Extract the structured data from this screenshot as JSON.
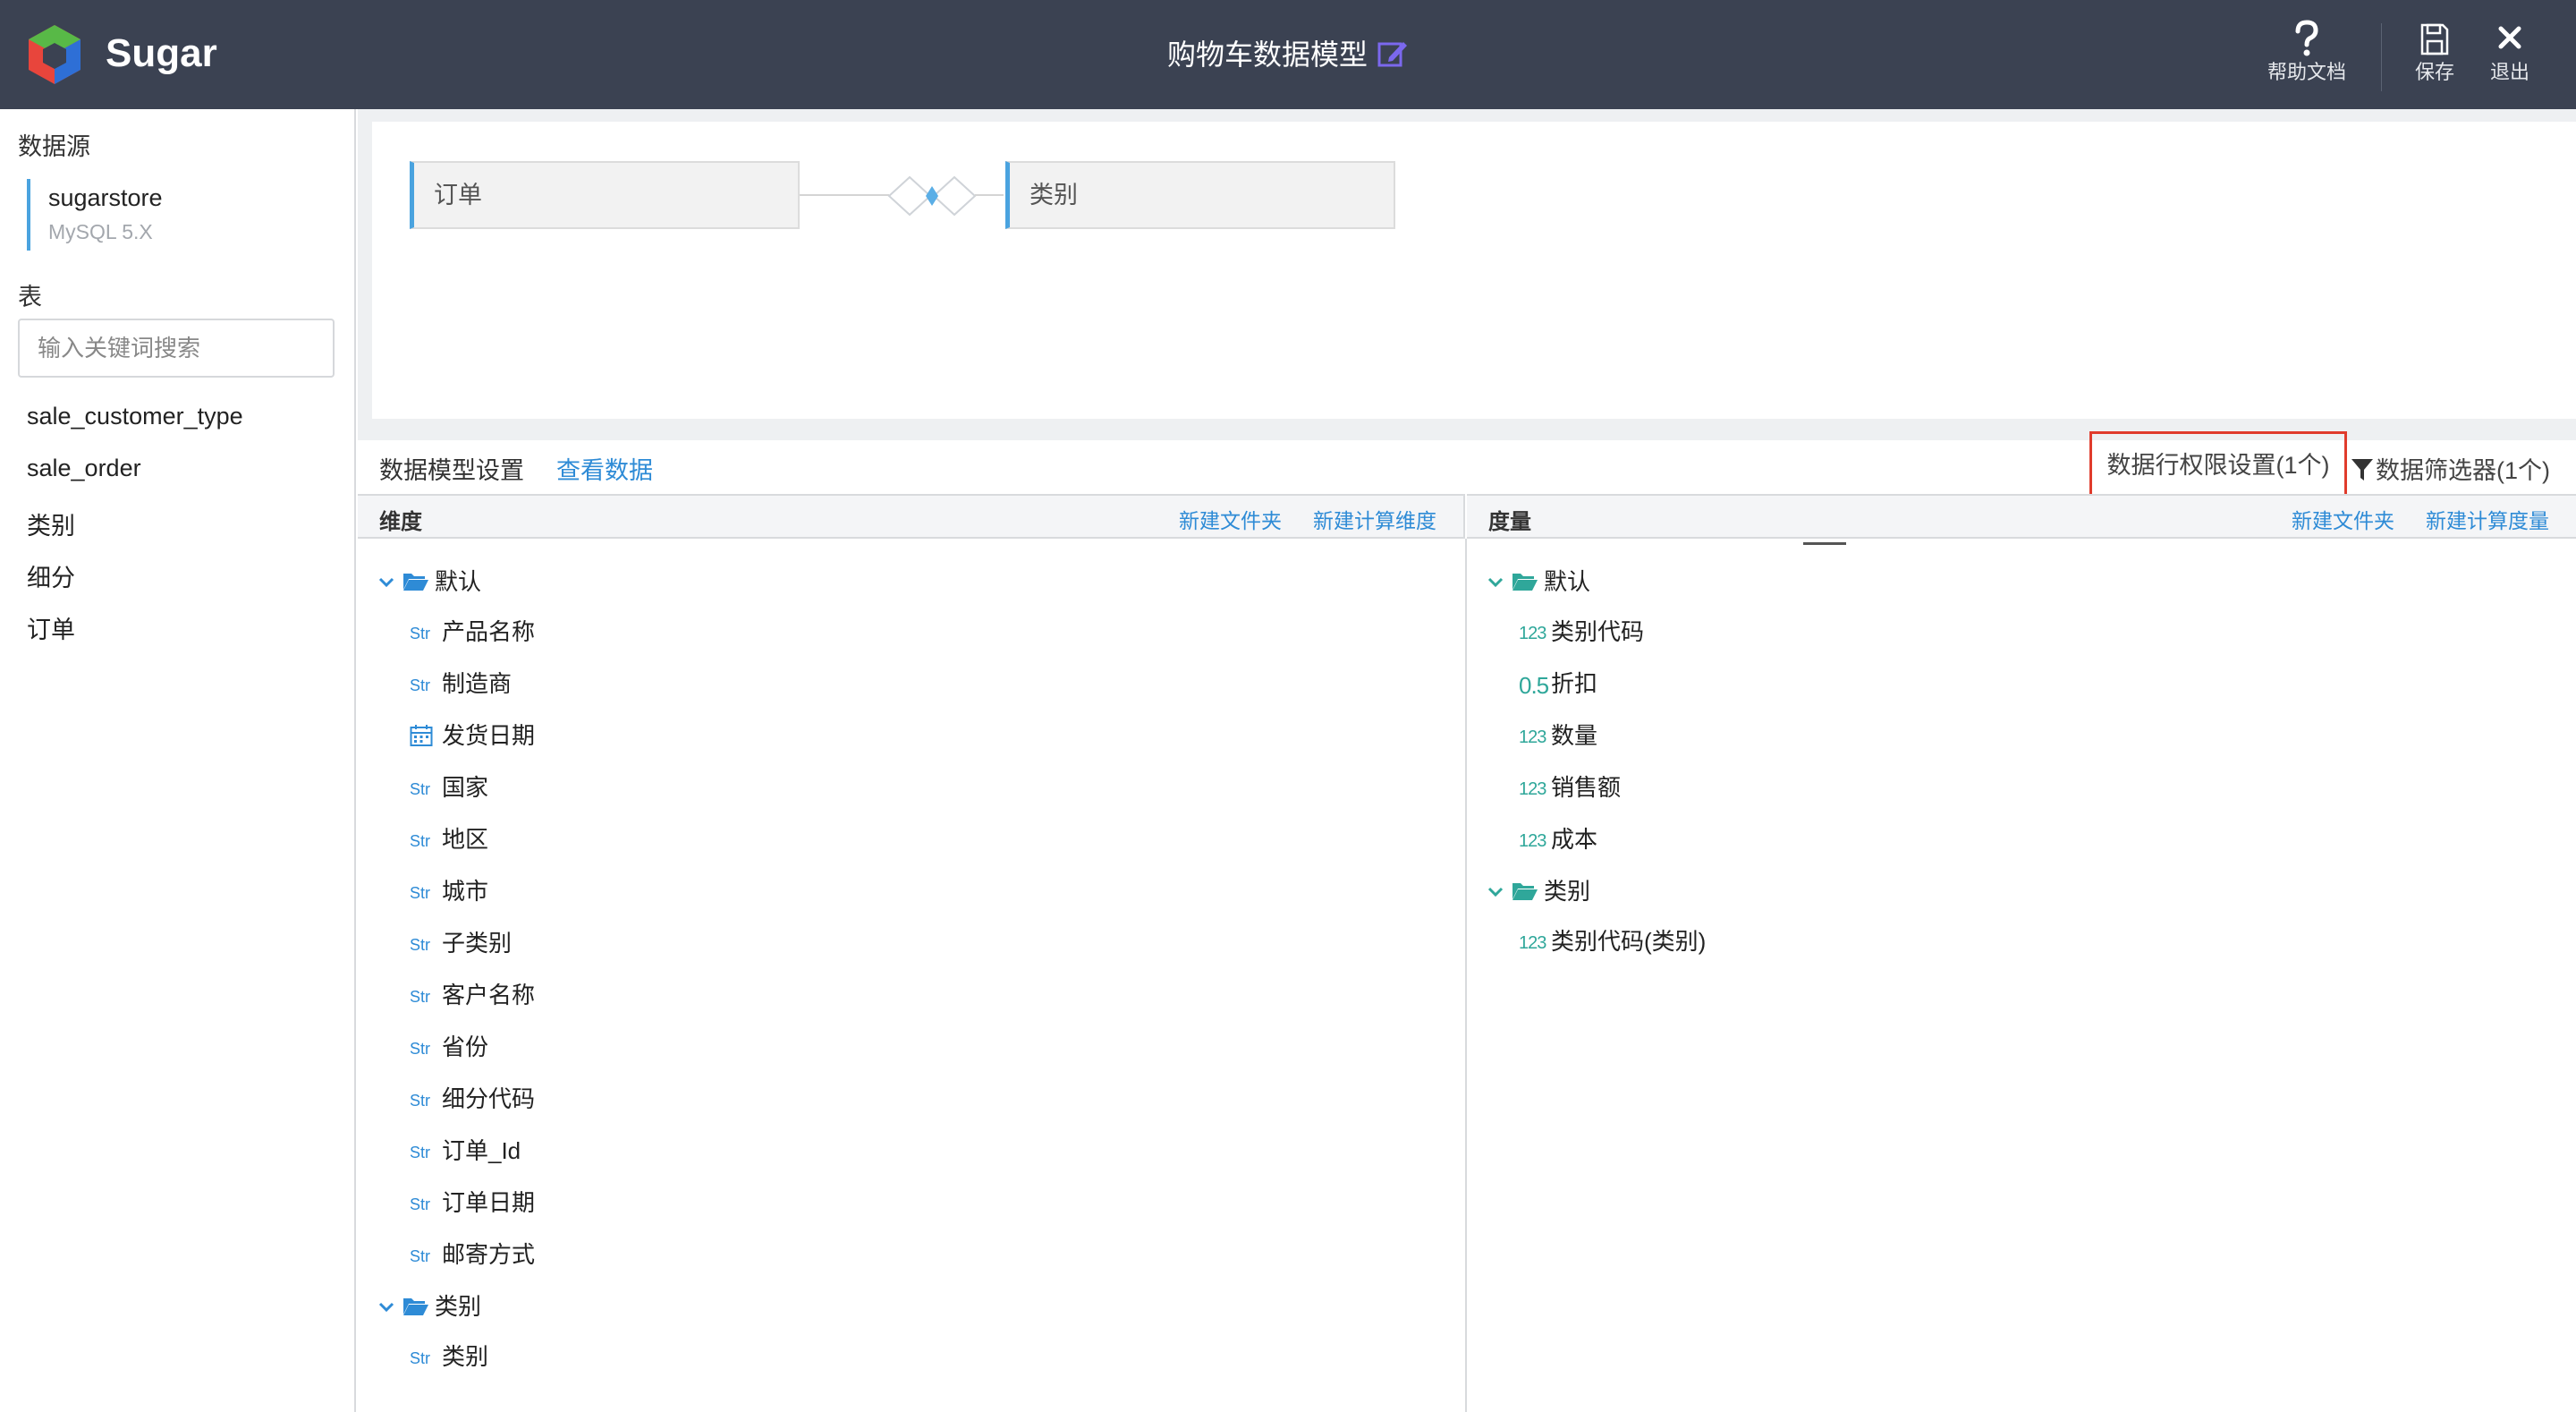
{
  "header": {
    "brand": "Sugar",
    "title": "购物车数据模型",
    "help_label": "帮助文档",
    "save_label": "保存",
    "exit_label": "退出"
  },
  "left": {
    "datasource_title": "数据源",
    "datasource_name": "sugarstore",
    "datasource_type": "MySQL 5.X",
    "table_title": "表",
    "search_placeholder": "输入关键词搜索",
    "tables": [
      "sale_customer_type",
      "sale_order",
      "类别",
      "细分",
      "订单"
    ]
  },
  "diagram": {
    "left_table": "订单",
    "right_table": "类别"
  },
  "toolbar": {
    "setting_tab": "数据模型设置",
    "view_tab": "查看数据",
    "row_permission": "数据行权限设置(1个)",
    "filter": "数据筛选器(1个)"
  },
  "dimension": {
    "title": "维度",
    "new_folder": "新建文件夹",
    "new_calc": "新建计算维度",
    "groups": [
      {
        "name": "默认",
        "fields": [
          {
            "type": "Str",
            "name": "产品名称"
          },
          {
            "type": "Str",
            "name": "制造商"
          },
          {
            "type": "date",
            "name": "发货日期"
          },
          {
            "type": "Str",
            "name": "国家"
          },
          {
            "type": "Str",
            "name": "地区"
          },
          {
            "type": "Str",
            "name": "城市"
          },
          {
            "type": "Str",
            "name": "子类别"
          },
          {
            "type": "Str",
            "name": "客户名称"
          },
          {
            "type": "Str",
            "name": "省份"
          },
          {
            "type": "Str",
            "name": "细分代码"
          },
          {
            "type": "Str",
            "name": "订单_Id"
          },
          {
            "type": "Str",
            "name": "订单日期"
          },
          {
            "type": "Str",
            "name": "邮寄方式"
          }
        ]
      },
      {
        "name": "类别",
        "fields": [
          {
            "type": "Str",
            "name": "类别"
          }
        ]
      }
    ]
  },
  "measure": {
    "title": "度量",
    "new_folder": "新建文件夹",
    "new_calc": "新建计算度量",
    "groups": [
      {
        "name": "默认",
        "fields": [
          {
            "type": "123",
            "name": "类别代码"
          },
          {
            "type": "0.5",
            "name": "折扣"
          },
          {
            "type": "123",
            "name": "数量"
          },
          {
            "type": "123",
            "name": "销售额"
          },
          {
            "type": "123",
            "name": "成本"
          }
        ]
      },
      {
        "name": "类别",
        "fields": [
          {
            "type": "123",
            "name": "类别代码(类别)"
          }
        ]
      }
    ]
  },
  "colors": {
    "header_bg": "#3b4252",
    "accent_blue": "#2e8bd6",
    "measure_teal": "#2fa79a",
    "highlight_red": "#e03b2c"
  }
}
